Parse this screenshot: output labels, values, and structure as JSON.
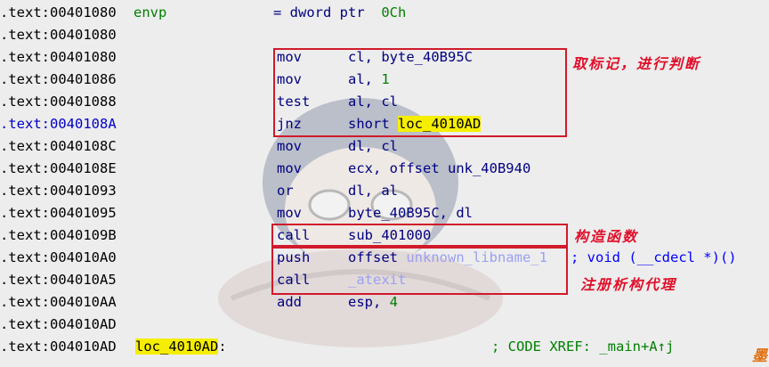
{
  "rows": [
    {
      "addr": ".text:00401080",
      "label": "envp",
      "op": "= dword ptr  ",
      "opnum": "0Ch"
    },
    {
      "addr": ".text:00401080"
    },
    {
      "addr": ".text:00401080",
      "mnemonic": "mov",
      "op": "cl, byte_40B95C"
    },
    {
      "addr": ".text:00401086",
      "mnemonic": "mov",
      "op": "al, ",
      "opnum": "1"
    },
    {
      "addr": ".text:00401088",
      "mnemonic": "test",
      "op": "al, cl"
    },
    {
      "addr": ".text:0040108A",
      "mnemonic": "jnz",
      "op": "short ",
      "ophl": "loc_4010AD",
      "current": true
    },
    {
      "addr": ".text:0040108C",
      "mnemonic": "mov",
      "op": "dl, cl"
    },
    {
      "addr": ".text:0040108E",
      "mnemonic": "mov",
      "op": "ecx, offset unk_40B940"
    },
    {
      "addr": ".text:00401093",
      "mnemonic": "or",
      "op": "dl, al"
    },
    {
      "addr": ".text:00401095",
      "mnemonic": "mov",
      "op": "byte_40B95C, dl"
    },
    {
      "addr": ".text:0040109B",
      "mnemonic": "call",
      "op": "sub_401000"
    },
    {
      "addr": ".text:004010A0",
      "mnemonic": "push",
      "op": "offset ",
      "oplib": "unknown_libname_1",
      "comment": "; void (__cdecl *)()"
    },
    {
      "addr": ".text:004010A5",
      "mnemonic": "call",
      "oplib": "_atexit"
    },
    {
      "addr": ".text:004010AA",
      "mnemonic": "add",
      "op": "esp, ",
      "opnum": "4"
    },
    {
      "addr": ".text:004010AD"
    },
    {
      "addr": ".text:004010AD",
      "labelhl": "loc_4010AD",
      "labelsuffix": ":",
      "xref": "; CODE XREF: _main+A↑j"
    }
  ],
  "annotations": {
    "flag_check": "取标记，进行判断",
    "constructor": "构造函数",
    "destructor": "注册析构代理"
  },
  "colors": {
    "highlight": "#f5ee00",
    "box": "#d11a2a",
    "annotation": "#e0102a",
    "mnemonic": "#000080",
    "number": "#008000"
  }
}
